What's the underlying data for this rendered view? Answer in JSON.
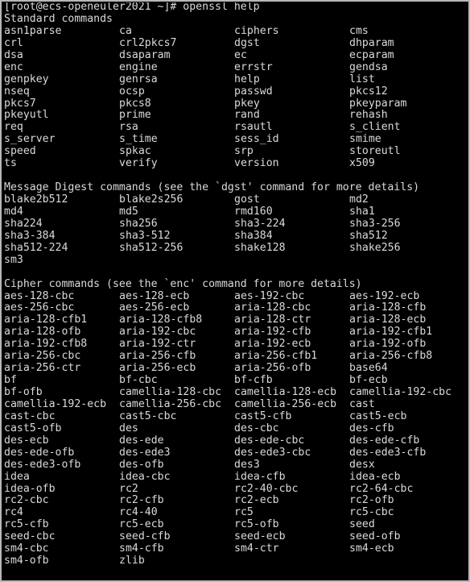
{
  "terminal": {
    "prompt_line": "[root@ecs-openeuler2021 ~]# openssl help",
    "prompt_user_host": "root@ecs-openeuler2021",
    "prompt_cwd": "~",
    "prompt_symbol": "#",
    "command": "openssl help",
    "colors": {
      "background": "#000000",
      "foreground": "#dadada",
      "window_border": "#b8b8b8",
      "desktop": "#808080"
    },
    "sections": [
      {
        "heading": "Standard commands",
        "rows": [
          [
            "asn1parse",
            "ca",
            "ciphers",
            "cms"
          ],
          [
            "crl",
            "crl2pkcs7",
            "dgst",
            "dhparam"
          ],
          [
            "dsa",
            "dsaparam",
            "ec",
            "ecparam"
          ],
          [
            "enc",
            "engine",
            "errstr",
            "gendsa"
          ],
          [
            "genpkey",
            "genrsa",
            "help",
            "list"
          ],
          [
            "nseq",
            "ocsp",
            "passwd",
            "pkcs12"
          ],
          [
            "pkcs7",
            "pkcs8",
            "pkey",
            "pkeyparam"
          ],
          [
            "pkeyutl",
            "prime",
            "rand",
            "rehash"
          ],
          [
            "req",
            "rsa",
            "rsautl",
            "s_client"
          ],
          [
            "s_server",
            "s_time",
            "sess_id",
            "smime"
          ],
          [
            "speed",
            "spkac",
            "srp",
            "storeutl"
          ],
          [
            "ts",
            "verify",
            "version",
            "x509"
          ]
        ]
      },
      {
        "heading": "Message Digest commands (see the `dgst' command for more details)",
        "rows": [
          [
            "blake2b512",
            "blake2s256",
            "gost",
            "md2"
          ],
          [
            "md4",
            "md5",
            "rmd160",
            "sha1"
          ],
          [
            "sha224",
            "sha256",
            "sha3-224",
            "sha3-256"
          ],
          [
            "sha3-384",
            "sha3-512",
            "sha384",
            "sha512"
          ],
          [
            "sha512-224",
            "sha512-256",
            "shake128",
            "shake256"
          ],
          [
            "sm3",
            "",
            "",
            ""
          ]
        ]
      },
      {
        "heading": "Cipher commands (see the `enc' command for more details)",
        "rows": [
          [
            "aes-128-cbc",
            "aes-128-ecb",
            "aes-192-cbc",
            "aes-192-ecb"
          ],
          [
            "aes-256-cbc",
            "aes-256-ecb",
            "aria-128-cbc",
            "aria-128-cfb"
          ],
          [
            "aria-128-cfb1",
            "aria-128-cfb8",
            "aria-128-ctr",
            "aria-128-ecb"
          ],
          [
            "aria-128-ofb",
            "aria-192-cbc",
            "aria-192-cfb",
            "aria-192-cfb1"
          ],
          [
            "aria-192-cfb8",
            "aria-192-ctr",
            "aria-192-ecb",
            "aria-192-ofb"
          ],
          [
            "aria-256-cbc",
            "aria-256-cfb",
            "aria-256-cfb1",
            "aria-256-cfb8"
          ],
          [
            "aria-256-ctr",
            "aria-256-ecb",
            "aria-256-ofb",
            "base64"
          ],
          [
            "bf",
            "bf-cbc",
            "bf-cfb",
            "bf-ecb"
          ],
          [
            "bf-ofb",
            "camellia-128-cbc",
            "camellia-128-ecb",
            "camellia-192-cbc"
          ],
          [
            "camellia-192-ecb",
            "camellia-256-cbc",
            "camellia-256-ecb",
            "cast"
          ],
          [
            "cast-cbc",
            "cast5-cbc",
            "cast5-cfb",
            "cast5-ecb"
          ],
          [
            "cast5-ofb",
            "des",
            "des-cbc",
            "des-cfb"
          ],
          [
            "des-ecb",
            "des-ede",
            "des-ede-cbc",
            "des-ede-cfb"
          ],
          [
            "des-ede-ofb",
            "des-ede3",
            "des-ede3-cbc",
            "des-ede3-cfb"
          ],
          [
            "des-ede3-ofb",
            "des-ofb",
            "des3",
            "desx"
          ],
          [
            "idea",
            "idea-cbc",
            "idea-cfb",
            "idea-ecb"
          ],
          [
            "idea-ofb",
            "rc2",
            "rc2-40-cbc",
            "rc2-64-cbc"
          ],
          [
            "rc2-cbc",
            "rc2-cfb",
            "rc2-ecb",
            "rc2-ofb"
          ],
          [
            "rc4",
            "rc4-40",
            "rc5",
            "rc5-cbc"
          ],
          [
            "rc5-cfb",
            "rc5-ecb",
            "rc5-ofb",
            "seed"
          ],
          [
            "seed-cbc",
            "seed-cfb",
            "seed-ecb",
            "seed-ofb"
          ],
          [
            "sm4-cbc",
            "sm4-cfb",
            "sm4-ctr",
            "sm4-ecb"
          ],
          [
            "sm4-ofb",
            "zlib",
            "",
            ""
          ]
        ]
      }
    ]
  }
}
